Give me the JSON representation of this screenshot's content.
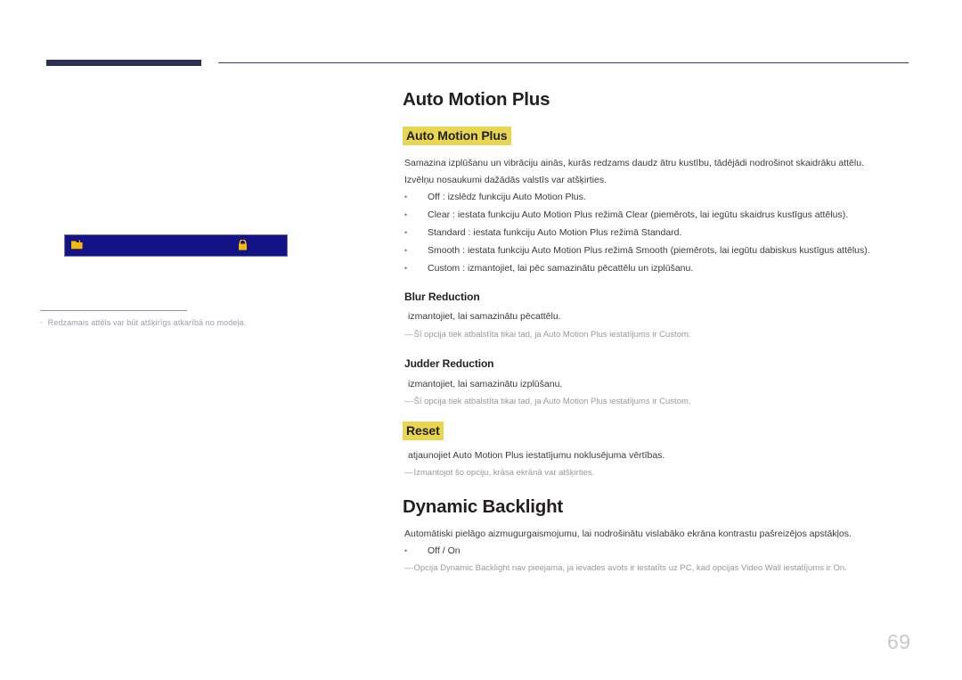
{
  "page": {
    "number": "69",
    "header_rule_color": "#2c3152",
    "accent_red": "#e0401c",
    "highlight_yellow": "#e8d652"
  },
  "left_panel": {
    "screen_mock": {
      "background": "#131386",
      "left_icon": "folder-icon",
      "right_icon": "lock-icon",
      "left_icon_glyph": "◩",
      "right_icon_glyph": "ὑ2"
    },
    "caption": {
      "dash": "-",
      "text": "Redzamais attēls var būt atšķirīgs atkarībā no modeļa."
    }
  },
  "main": {
    "section1": {
      "title": "Auto Motion Plus",
      "highlight_head": "Auto Motion Plus",
      "intro_line1": "Samazina izplūšanu un vibrāciju ainās, kurās redzams daudz ātru kustību, tādējādi nodrošinot skaidrāku attēlu.",
      "intro_line2": "Izvēlņu nosaukumi dažādās valstīs var atšķirties.",
      "bullets": [
        {
          "marker": "•",
          "parts": [
            {
              "t": "Off",
              "s": "kw"
            },
            {
              "t": " : izslēdz funkciju ",
              "s": "plain"
            },
            {
              "t": "Auto Motion Plus",
              "s": "kw"
            },
            {
              "t": ".",
              "s": "plain"
            }
          ]
        },
        {
          "marker": "•",
          "parts": [
            {
              "t": "Clear",
              "s": "kw"
            },
            {
              "t": " : iestata funkciju ",
              "s": "plain"
            },
            {
              "t": "Auto Motion Plus",
              "s": "kw"
            },
            {
              "t": " režimā ",
              "s": "plain"
            },
            {
              "t": "Clear",
              "s": "kw"
            },
            {
              "t": " (piemērots, lai iegūtu skaidrus kustīgus attēlus).",
              "s": "plain"
            }
          ]
        },
        {
          "marker": "•",
          "parts": [
            {
              "t": "Standard",
              "s": "kw"
            },
            {
              "t": " : iestata funkciju ",
              "s": "plain"
            },
            {
              "t": "Auto Motion Plus",
              "s": "kw"
            },
            {
              "t": " režimā ",
              "s": "plain"
            },
            {
              "t": "Standard",
              "s": "kw"
            },
            {
              "t": ".",
              "s": "plain"
            }
          ]
        },
        {
          "marker": "•",
          "parts": [
            {
              "t": "Smooth",
              "s": "kw"
            },
            {
              "t": " : iestata funkciju ",
              "s": "plain"
            },
            {
              "t": "Auto Motion Plus",
              "s": "kw"
            },
            {
              "t": " režimā ",
              "s": "plain"
            },
            {
              "t": "Smooth",
              "s": "kw"
            },
            {
              "t": " (piemērots, lai iegūtu dabiskus kustīgus attēlus).",
              "s": "plain"
            }
          ]
        },
        {
          "marker": "•",
          "parts": [
            {
              "t": "Custom",
              "s": "kw"
            },
            {
              "t": " : izmantojiet, lai pēc samazinātu pēcattēlu un izplūšanu.",
              "s": "plain"
            }
          ]
        }
      ],
      "blur_reduction": {
        "heading": "Blur Reduction",
        "body": "izmantojiet, lai samazinātu pēcattēlu.",
        "note": {
          "emdash": "—",
          "parts": [
            {
              "t": "Šī opcija tiek atbalstīta tikai tad, ja ",
              "s": "plain"
            },
            {
              "t": "Auto Motion Plus",
              "s": "kw"
            },
            {
              "t": " iestatījums ir ",
              "s": "plain"
            },
            {
              "t": "Custom",
              "s": "kw"
            },
            {
              "t": ".",
              "s": "plain"
            }
          ]
        }
      },
      "judder_reduction": {
        "heading": "Judder Reduction",
        "body": "izmantojiet, lai samazinātu izplūšanu.",
        "note": {
          "emdash": "—",
          "parts": [
            {
              "t": "Šī opcija tiek atbalstīta tikai tad, ja ",
              "s": "plain"
            },
            {
              "t": "Auto Motion Plus",
              "s": "kw"
            },
            {
              "t": " iestatījums ir ",
              "s": "plain"
            },
            {
              "t": "Custom",
              "s": "kw"
            },
            {
              "t": ".",
              "s": "plain"
            }
          ]
        }
      },
      "reset": {
        "highlight_head": "Reset",
        "body_parts": [
          {
            "t": "atjaunojiet ",
            "s": "plain"
          },
          {
            "t": "Auto Motion Plus",
            "s": "kw"
          },
          {
            "t": " iestatījumu noklusējuma vērtības.",
            "s": "plain"
          }
        ],
        "note": {
          "emdash": "—",
          "parts": [
            {
              "t": "Izmantojot šo opciju, krāsa ekrānā var atšķirties.",
              "s": "plain"
            }
          ]
        }
      }
    },
    "section2": {
      "title": "Dynamic Backlight",
      "intro": "Automātiski pielāgo aizmugurgaismojumu, lai nodrošinātu vislabāko ekrāna kontrastu pašreizējos apstākļos.",
      "bullets": [
        {
          "marker": "•",
          "parts": [
            {
              "t": "Off",
              "s": "kw"
            },
            {
              "t": " / ",
              "s": "plain"
            },
            {
              "t": "On",
              "s": "kw"
            }
          ]
        }
      ],
      "note": {
        "emdash": "—",
        "parts": [
          {
            "t": "Opcija ",
            "s": "plain"
          },
          {
            "t": "Dynamic Backlight",
            "s": "kw"
          },
          {
            "t": " nav pieejama, ja ievades avots ir iestatīts uz ",
            "s": "plain"
          },
          {
            "t": "PC",
            "s": "kw"
          },
          {
            "t": ", kad opcijas ",
            "s": "plain"
          },
          {
            "t": "Video Wall",
            "s": "kw"
          },
          {
            "t": " iestatījums ir ",
            "s": "plain"
          },
          {
            "t": "On",
            "s": "kw"
          },
          {
            "t": ".",
            "s": "plain"
          }
        ]
      }
    }
  }
}
